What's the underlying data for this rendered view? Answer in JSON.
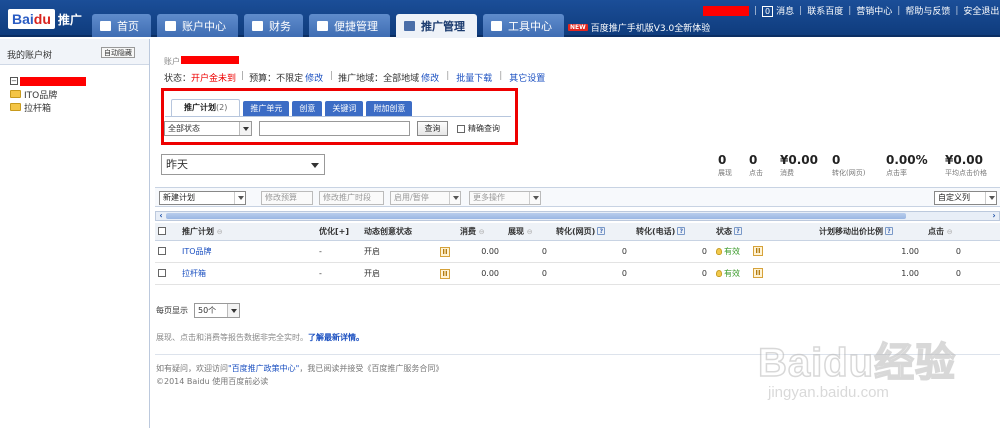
{
  "header": {
    "logo_text": "Bai",
    "logo_du": "du",
    "logo_suffix": "推广",
    "nav": [
      {
        "label": "首页",
        "icon": "home-icon"
      },
      {
        "label": "账户中心",
        "icon": "user-icon"
      },
      {
        "label": "财务",
        "icon": "wallet-icon"
      },
      {
        "label": "便捷管理",
        "icon": "monitor-icon"
      },
      {
        "label": "推广管理",
        "icon": "grid-icon",
        "active": true
      },
      {
        "label": "工具中心",
        "icon": "briefcase-icon"
      }
    ],
    "promo_badge": "NEW",
    "promo_text": "百度推广手机版V3.0全新体验",
    "msg_count": "0",
    "links": [
      "消息",
      "联系百度",
      "营销中心",
      "帮助与反馈",
      "安全退出"
    ]
  },
  "sidebar": {
    "title": "我的账户树",
    "hide_label": "自动隐藏",
    "items": [
      "ITO品牌",
      "拉杆箱"
    ]
  },
  "account": {
    "prefix": "账户",
    "status_label": "状态：",
    "status_value": "开户金未到",
    "budget_label": "预算：不限定",
    "budget_edit": "修改",
    "region_label": "推广地域：全部地域",
    "region_edit": "修改",
    "bulk_download": "批量下载",
    "other_settings": "其它设置"
  },
  "subtabs": [
    {
      "label": "推广计划",
      "count": "(2)",
      "active": true
    },
    {
      "label": "推广单元"
    },
    {
      "label": "创意"
    },
    {
      "label": "关键词"
    },
    {
      "label": "附加创意"
    }
  ],
  "filter": {
    "status_select": "全部状态",
    "search_button": "查询",
    "exact_label": "精确查询"
  },
  "date_select": "昨天",
  "stats": [
    {
      "value": "0",
      "label": "展现"
    },
    {
      "value": "0",
      "label": "点击"
    },
    {
      "value": "¥0.00",
      "label": "消费"
    },
    {
      "value": "0",
      "label": "转化(网页)"
    },
    {
      "value": "0.00%",
      "label": "点击率"
    },
    {
      "value": "¥0.00",
      "label": "平均点击价格"
    }
  ],
  "toolbar": {
    "new_plan": "新建计划",
    "edit_budget": "修改预算",
    "edit_time": "修改推广时段",
    "enable_pause": "启用/暂停",
    "more_ops": "更多操作",
    "custom_columns": "自定义列"
  },
  "table": {
    "headers": [
      "推广计划",
      "优化[+]",
      "动态创意状态",
      "消费",
      "展现",
      "转化(网页)",
      "转化(电话)",
      "状态",
      "计划移动出价比例",
      "点击"
    ],
    "rows": [
      {
        "name": "ITO品牌",
        "opt": "-",
        "dynamic": "开启",
        "cost": "0.00",
        "impr": "0",
        "conv_web": "0",
        "conv_phone": "0",
        "status": "有效",
        "ratio": "1.00",
        "clicks": "0"
      },
      {
        "name": "拉杆箱",
        "opt": "-",
        "dynamic": "开启",
        "cost": "0.00",
        "impr": "0",
        "conv_web": "0",
        "conv_phone": "0",
        "status": "有效",
        "ratio": "1.00",
        "clicks": "0"
      }
    ]
  },
  "pagesize": {
    "label": "每页显示",
    "value": "50个"
  },
  "note": {
    "text": "展现、点击和消费等报告数据非完全实时。",
    "link": "了解最新详情。"
  },
  "footer": {
    "line1_pre": "如有疑问，欢迎访问",
    "line1_link": "\"百度推广政策中心\"",
    "line1_post": "，我已阅读并接受《百度推广服务合同》",
    "line2": "©2014 Baidu 使用百度前必读"
  },
  "watermark": {
    "big": "Baidu经验",
    "small": "jingyan.baidu.com"
  }
}
